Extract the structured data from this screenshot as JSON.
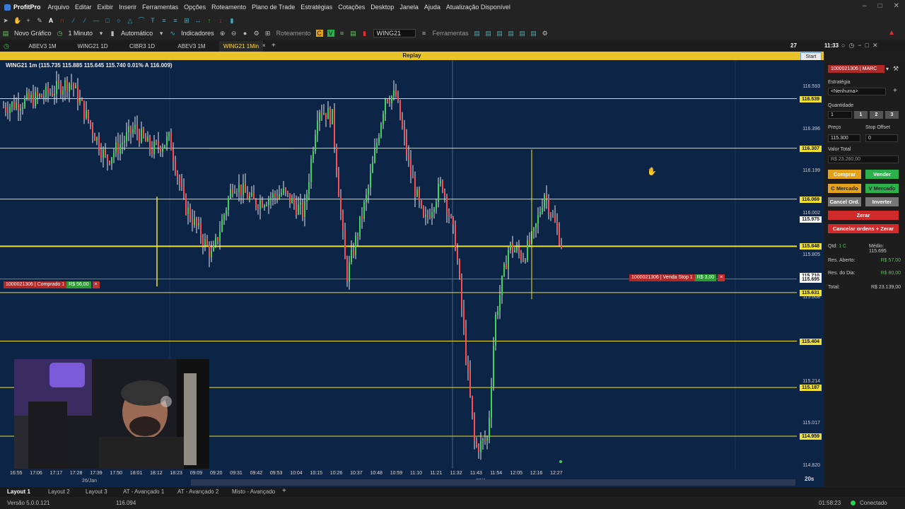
{
  "app": {
    "name": "ProfitPro",
    "menu": [
      "Arquivo",
      "Editar",
      "Exibir",
      "Inserir",
      "Ferramentas",
      "Opções",
      "Roteamento",
      "Plano de Trade",
      "Estratégias",
      "Cotações",
      "Desktop",
      "Janela",
      "Ajuda",
      "Atualização Disponível"
    ]
  },
  "toolbar": {
    "new_chart": "Novo Gráfico",
    "interval": "1 Minuto",
    "mode": "Automático",
    "indicators": "Indicadores",
    "routing": "Roteamento",
    "symbol": "WING21",
    "tools": "Ferramentas"
  },
  "chart_tabs": [
    {
      "label": "ABEV3 1M",
      "active": false
    },
    {
      "label": "WING21 1D",
      "active": false
    },
    {
      "label": "CIBR3 1D",
      "active": false
    },
    {
      "label": "ABEV3 1M",
      "active": false
    },
    {
      "label": "WING21 1Min",
      "active": true
    }
  ],
  "top_right": {
    "time": "11:33",
    "start_label": "Start",
    "day_prefix": "27"
  },
  "replay_label": "Replay",
  "chart": {
    "title": "WING21 1m (115.735  115.885  115.645  115.740  0.01%  A 116.009)",
    "price_tags": [
      "116.539",
      "116.307",
      "116.069",
      "115.975",
      "115.848",
      "115.710",
      "115.695",
      "115.631",
      "115.404",
      "115.187",
      "114.959"
    ],
    "price_ticks": [
      "116.593",
      "116.396",
      "116.199",
      "116.002",
      "115.805",
      "115.608",
      "115.214",
      "115.017",
      "114.820"
    ],
    "buy_order": {
      "account": "1000021306 | Comprado 1",
      "pnl": "R$ 56,00",
      "close": "×"
    },
    "stop_order": {
      "account": "1000021306 | Venda Stop 1",
      "pnl": "R$ 3,00",
      "close": "×"
    },
    "time_labels": [
      "16:55",
      "17:06",
      "17:17",
      "17:28",
      "17:39",
      "17:50",
      "18:01",
      "18:12",
      "18:23",
      "09:09",
      "09:20",
      "09:31",
      "09:42",
      "09:53",
      "10:04",
      "10:15",
      "10:26",
      "10:37",
      "10:48",
      "10:59",
      "11:10",
      "11:21",
      "11:32",
      "11:43",
      "11:54",
      "12:05",
      "12:16",
      "12:27"
    ],
    "date_labels": [
      "26/Jan",
      "27/Jan"
    ],
    "zoom": "20s"
  },
  "chart_data": {
    "type": "candlestick",
    "title": "WING21 1m",
    "y_range": [
      114.8,
      116.66
    ],
    "horizontal_levels": [
      116.539,
      116.307,
      116.069,
      115.848,
      115.631,
      115.404,
      115.187,
      114.959
    ],
    "last_price": 115.74
  },
  "order_panel": {
    "account": "1000021306 | MARC",
    "strategy_label": "Estratégia",
    "strategy_value": "<Nenhuma>",
    "qty_label": "Quantidade",
    "qty_value": "1",
    "qty_presets": [
      "1",
      "2",
      "3"
    ],
    "price_label": "Preço",
    "price_value": "115.300",
    "stop_offset_label": "Stop Offset",
    "stop_offset_value": "0",
    "total_label": "Valor Total",
    "total_value": "R$ 23.260,00",
    "buttons": {
      "buy": "Comprar",
      "sell": "Vender",
      "buy_market": "C Mercado",
      "sell_market": "V Mercado",
      "cancel": "Cancel Ord.",
      "invert": "Inverter",
      "zero": "Zerar",
      "cancel_zero": "Cancelar ordens + Zerar"
    },
    "qtd_label": "Qtd:",
    "qtd_value": "1 C",
    "avg_label": "Médio:",
    "avg_value": "115.695",
    "open_label": "Res. Aberto:",
    "open_value": "R$ 57,00",
    "day_label": "Res. do Dia:",
    "day_value": "R$ 80,00",
    "total2_label": "Total:",
    "total2_value": "R$ 23.139,00"
  },
  "layouts": [
    "Layout 1",
    "Layout 2",
    "Layout 3",
    "AT - Avançado 1",
    "AT - Avançado 2",
    "Misto - Avançado"
  ],
  "status": {
    "version": "Versão 5.0.0.121",
    "price": "116.094",
    "clock": "01:58:23",
    "connection": "Conectado"
  },
  "colors": {
    "chart_bg": "#0c2445",
    "level_line": "#f0e030",
    "up": "#3cd35a",
    "down": "#ff4d4d",
    "buy": "#e3a21a",
    "sell": "#2bb24c",
    "zero": "#d12a2a"
  }
}
